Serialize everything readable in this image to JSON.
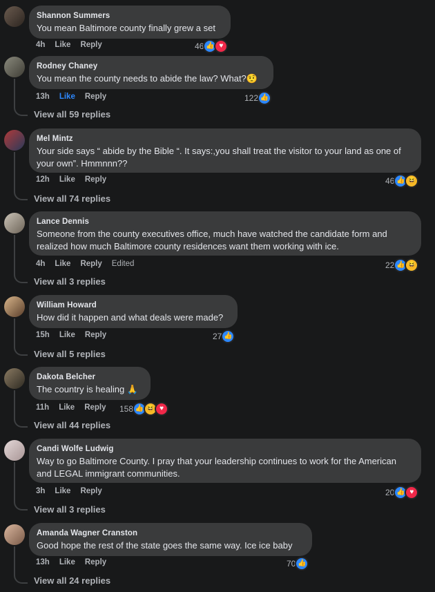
{
  "comments": [
    {
      "author": "Shannon Summers",
      "text": "You mean Baltimore county finally grew a set",
      "time": "4h",
      "like": "Like",
      "reply": "Reply",
      "edited": "",
      "reaction_count": "46",
      "reactions": [
        "like",
        "love"
      ],
      "view_replies": ""
    },
    {
      "author": "Rodney Chaney",
      "text": "You mean the county needs to abide the law? What?",
      "text_emoji": "🤨",
      "time": "13h",
      "like": "Like",
      "reply": "Reply",
      "edited": "",
      "liked": true,
      "reaction_count": "122",
      "reactions": [
        "like"
      ],
      "view_replies": "View all 59 replies"
    },
    {
      "author": "Mel Mintz",
      "text": "Your side says “ abide by the Bible “. It says:,you shall treat the visitor to your land as one of your own”. Hmmnnn??",
      "time": "12h",
      "like": "Like",
      "reply": "Reply",
      "edited": "",
      "reaction_count": "46",
      "reactions": [
        "like",
        "haha"
      ],
      "view_replies": "View all 74 replies"
    },
    {
      "author": "Lance Dennis",
      "text": "Someone from the county executives office, much have watched the candidate form and realized how much Baltimore county residences want them working with ice.",
      "time": "4h",
      "like": "Like",
      "reply": "Reply",
      "edited": "Edited",
      "reaction_count": "22",
      "reactions": [
        "like",
        "haha"
      ],
      "view_replies": "View all 3 replies"
    },
    {
      "author": "William Howard",
      "text": "How did it happen and what deals were made?",
      "time": "15h",
      "like": "Like",
      "reply": "Reply",
      "edited": "",
      "reaction_count": "27",
      "reactions": [
        "like"
      ],
      "view_replies": "View all 5 replies"
    },
    {
      "author": "Dakota Belcher",
      "text": "The country is healing",
      "text_emoji": "🙏",
      "time": "11h",
      "like": "Like",
      "reply": "Reply",
      "edited": "",
      "reaction_count": "158",
      "reactions": [
        "like",
        "haha",
        "love"
      ],
      "view_replies": "View all 44 replies"
    },
    {
      "author": "Candi Wolfe Ludwig",
      "text": "Way to go Baltimore County. I pray that your leadership continues to work for the American and LEGAL immigrant communities.",
      "time": "3h",
      "like": "Like",
      "reply": "Reply",
      "edited": "",
      "reaction_count": "20",
      "reactions": [
        "like",
        "love"
      ],
      "view_replies": "View all 3 replies"
    },
    {
      "author": "Amanda Wagner Cranston",
      "text": "Good hope the rest of the state goes the same way. Ice ice baby",
      "time": "13h",
      "like": "Like",
      "reply": "Reply",
      "edited": "",
      "reaction_count": "70",
      "reactions": [
        "like"
      ],
      "view_replies": "View all 24 replies"
    }
  ],
  "colors": {
    "background": "#18191a",
    "bubble": "#3a3b3c",
    "secondary_text": "#b0b3b8",
    "link_blue": "#2d88ff"
  }
}
